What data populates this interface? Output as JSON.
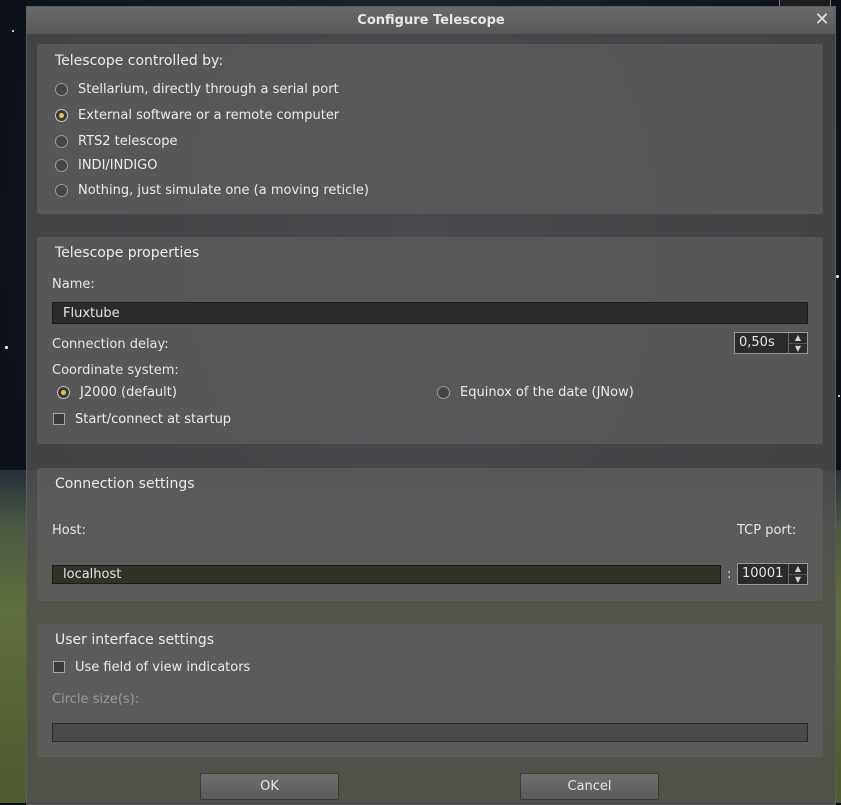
{
  "dialog": {
    "title": "Configure Telescope"
  },
  "controlled_by": {
    "title": "Telescope controlled by:",
    "options": [
      {
        "label": "Stellarium, directly through a serial port",
        "checked": false
      },
      {
        "label": "External software or a remote computer",
        "checked": true
      },
      {
        "label": "RTS2 telescope",
        "checked": false
      },
      {
        "label": "INDI/INDIGO",
        "checked": false
      },
      {
        "label": "Nothing, just simulate one (a moving reticle)",
        "checked": false
      }
    ]
  },
  "properties": {
    "title": "Telescope properties",
    "name_label": "Name:",
    "name_value": "Fluxtube",
    "delay_label": "Connection delay:",
    "delay_value": "0,50s",
    "coord_label": "Coordinate system:",
    "coord_j2000": "J2000 (default)",
    "coord_jnow": "Equinox of the date (JNow)",
    "coord_selected": "j2000",
    "startup_label": "Start/connect at startup",
    "startup_checked": false
  },
  "connection": {
    "title": "Connection settings",
    "host_label": "Host:",
    "port_label": "TCP port:",
    "host_value": "localhost",
    "separator": ":",
    "port_value": "10001"
  },
  "ui_settings": {
    "title": "User interface settings",
    "fov_label": "Use field of view indicators",
    "fov_checked": false,
    "circle_label": "Circle size(s):",
    "circle_value": ""
  },
  "buttons": {
    "ok": "OK",
    "cancel": "Cancel"
  },
  "icons": {
    "close": "close-icon",
    "spin_up": "chevron-up-icon",
    "spin_down": "chevron-down-icon"
  }
}
